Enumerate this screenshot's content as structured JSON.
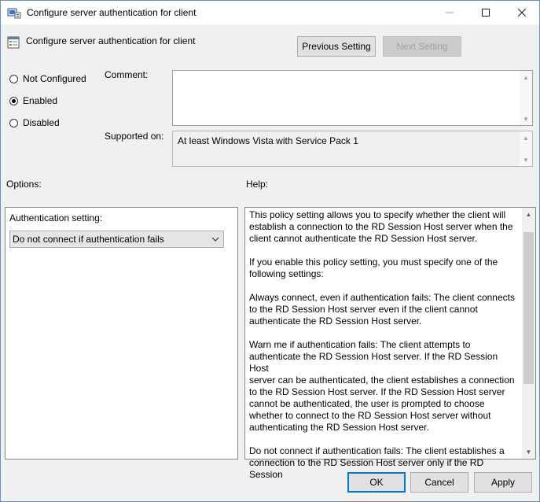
{
  "window": {
    "title": "Configure server authentication for client",
    "controls": {
      "minimize": "minimize",
      "maximize": "maximize",
      "close": "close"
    }
  },
  "header": {
    "title": "Configure server authentication for client",
    "prev_label": "Previous Setting",
    "next_label": "Next Setting"
  },
  "state": {
    "options": [
      "Not Configured",
      "Enabled",
      "Disabled"
    ],
    "selected": "Enabled"
  },
  "comment": {
    "label": "Comment:",
    "value": ""
  },
  "supported": {
    "label": "Supported on:",
    "value": "At least Windows Vista with Service Pack 1"
  },
  "options_section": {
    "label": "Options:",
    "setting_label": "Authentication setting:",
    "setting_value": "Do not connect if authentication fails"
  },
  "help_section": {
    "label": "Help:",
    "text": "This policy setting allows you to specify whether the client will\nestablish a connection to the RD Session Host server when the\nclient cannot authenticate the RD Session Host server.\n\nIf you enable this policy setting, you must specify one of the\nfollowing settings:\n\nAlways connect, even if authentication fails: The client connects\nto the RD Session Host server even if the client cannot\nauthenticate the RD Session Host server.\n\nWarn me if authentication fails: The client attempts to\nauthenticate the RD Session Host server. If the RD Session Host\nserver can be authenticated, the client establishes a connection\nto the RD Session Host server. If the RD Session Host server\ncannot be authenticated, the user is prompted to choose\nwhether to connect to the RD Session Host server without\nauthenticating the RD Session Host server.\n\nDo not connect if authentication fails: The client establishes a\nconnection to the RD Session Host server only if the RD Session"
  },
  "footer": {
    "ok_label": "OK",
    "cancel_label": "Cancel",
    "apply_label": "Apply"
  },
  "colors": {
    "accent": "#0078d7",
    "face": "#f0f0f0",
    "button": "#e1e1e1"
  },
  "icons": {
    "title": "policy-icon",
    "header": "settings-page-icon"
  }
}
